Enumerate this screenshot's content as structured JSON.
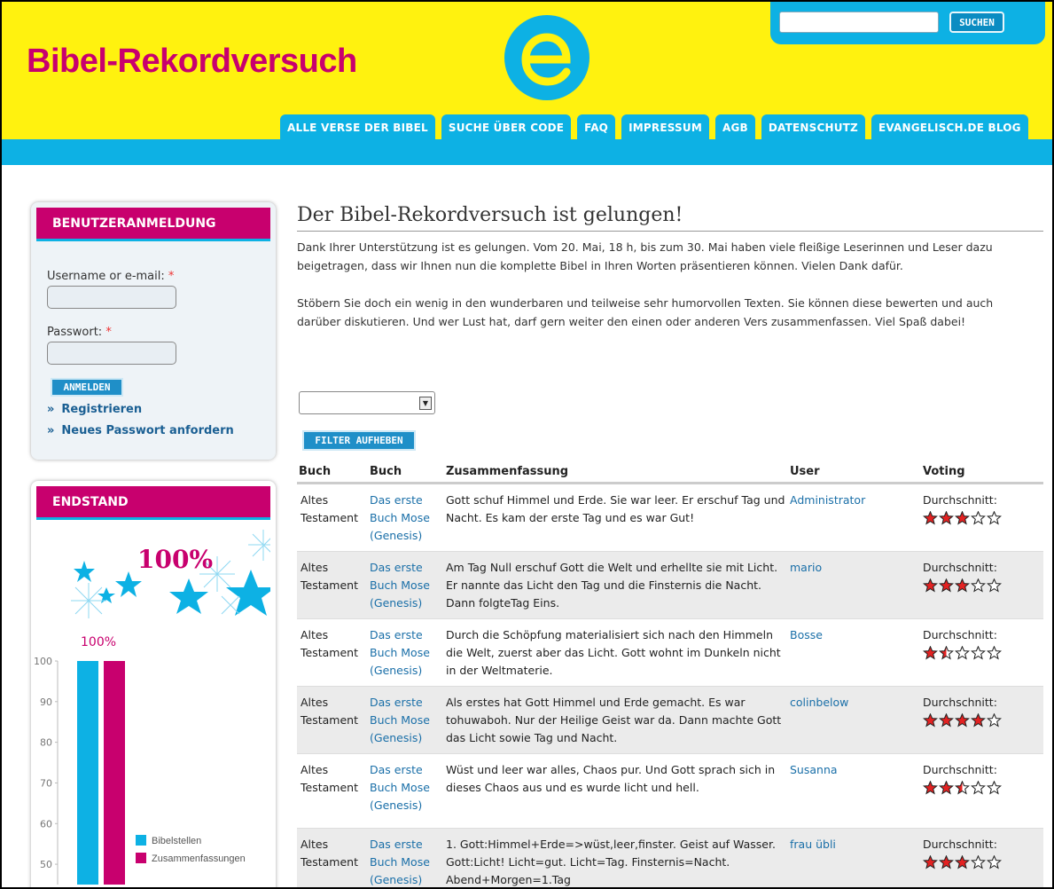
{
  "header": {
    "site_title": "Bibel-Rekordversuch",
    "logo_letter": "e",
    "search_placeholder": "",
    "search_button": "SUCHEN",
    "nav": [
      "ALLE VERSE DER BIBEL",
      "SUCHE ÜBER CODE",
      "FAQ",
      "IMPRESSUM",
      "AGB",
      "DATENSCHUTZ",
      "EVANGELISCH.DE BLOG"
    ]
  },
  "colors": {
    "header_yellow": "#fff20f",
    "brand_blue": "#0db1e4",
    "brand_magenta": "#c8006e"
  },
  "login": {
    "title": "BENUTZERANMELDUNG",
    "username_label": "Username or e-mail:",
    "password_label": "Passwort:",
    "required_mark": "*",
    "submit": "ANMELDEN",
    "links": [
      "Registrieren",
      "Neues Passwort anfordern"
    ],
    "link_marker": "»"
  },
  "endstand": {
    "title": "ENDSTAND",
    "big_percent": "100%",
    "chart_data": {
      "type": "bar",
      "categories": [
        "Bibelstellen",
        "Zusammenfassungen"
      ],
      "values": [
        100,
        100
      ],
      "annotation": "100%",
      "ylim": [
        45,
        100
      ],
      "yticks": [
        "100",
        "90",
        "80",
        "70",
        "60",
        "50"
      ],
      "legend": [
        "Bibelstellen",
        "Zusammenfassungen"
      ],
      "colors": [
        "#0db1e4",
        "#c8006e"
      ]
    }
  },
  "main": {
    "title": "Der Bibel-Rekordversuch ist gelungen!",
    "paragraph1": "Dank Ihrer Unterstützung ist es gelungen. Vom 20. Mai, 18 h, bis zum 30. Mai haben viele fleißige Leserinnen und Leser dazu beigetragen, dass wir Ihnen nun die komplette Bibel in Ihren Worten präsentieren können. Vielen Dank dafür.",
    "paragraph2": "Stöbern Sie doch ein wenig in den wunderbaren und teilweise sehr humorvollen Texten. Sie können diese bewerten und auch darüber diskutieren. Und wer Lust hat, darf gern weiter den einen oder anderen Vers zusammenfassen. Viel Spaß dabei!",
    "select_value": "",
    "filter_button": "FILTER AUFHEBEN"
  },
  "table": {
    "headers": [
      "Buch",
      "Buch",
      "Zusammenfassung",
      "User",
      "Voting"
    ],
    "voting_label": "Durchschnitt:",
    "rows": [
      {
        "testament": "Altes Testament",
        "book": "Das erste Buch Mose (Genesis)",
        "summary": "Gott schuf Himmel und Erde. Sie war leer. Er erschuf Tag und Nacht. Es kam der erste Tag und es war Gut!",
        "user": "Administrator",
        "rating": 3
      },
      {
        "testament": "Altes Testament",
        "book": "Das erste Buch Mose (Genesis)",
        "summary": "Am Tag Null erschuf Gott die Welt und erhellte sie mit Licht. Er nannte das Licht den Tag und die Finsternis die Nacht. Dann folgteTag Eins.",
        "user": "mario",
        "rating": 3
      },
      {
        "testament": "Altes Testament",
        "book": "Das erste Buch Mose (Genesis)",
        "summary": "Durch die Schöpfung materialisiert sich nach den Himmeln die Welt, zuerst aber das Licht. Gott wohnt im Dunkeln nicht in der Weltmaterie.",
        "user": "Bosse",
        "rating": 1.5
      },
      {
        "testament": "Altes Testament",
        "book": "Das erste Buch Mose (Genesis)",
        "summary": "Als erstes hat Gott Himmel und Erde gemacht. Es war tohuwaboh. Nur der Heilige Geist war da. Dann machte Gott das Licht sowie Tag und Nacht.",
        "user": "colinbelow",
        "rating": 4
      },
      {
        "testament": "Altes Testament",
        "book": "Das erste Buch Mose (Genesis)",
        "summary": "Wüst und leer war alles, Chaos pur. Und Gott sprach sich in dieses Chaos aus und es wurde licht und hell.",
        "user": "Susanna",
        "rating": 2.5
      },
      {
        "testament": "Altes Testament",
        "book": "Das erste Buch Mose (Genesis)",
        "summary": "1. Gott:Himmel+Erde=>wüst,leer,finster. Geist auf Wasser. Gott:Licht! Licht=gut. Licht=Tag. Finsternis=Nacht. Abend+Morgen=1.Tag",
        "user": "frau übli",
        "rating": 3
      }
    ]
  }
}
